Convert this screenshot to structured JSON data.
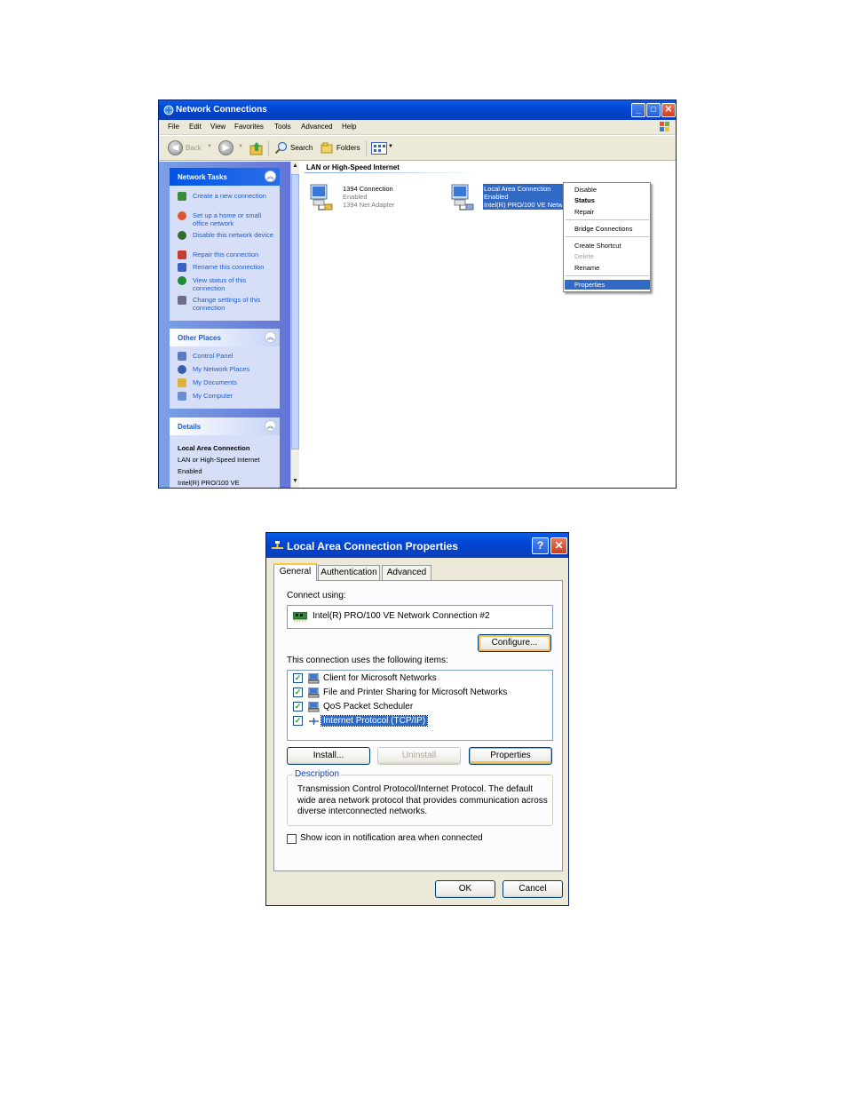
{
  "network_connections": {
    "title": "Network Connections",
    "menu": [
      "File",
      "Edit",
      "View",
      "Favorites",
      "Tools",
      "Advanced",
      "Help"
    ],
    "toolbar": {
      "back": "Back",
      "search": "Search",
      "folders": "Folders"
    },
    "network_tasks": {
      "header": "Network Tasks",
      "items": [
        {
          "label": "Create a new connection",
          "icon": "new-connection-icon",
          "color": "#3c8c3c"
        },
        {
          "label": "Set up a home or small office network",
          "icon": "home-network-icon",
          "color": "#d9572b"
        },
        {
          "label": "Disable this network device",
          "icon": "disable-device-icon",
          "color": "#2d6e2d"
        },
        {
          "label": "Repair this connection",
          "icon": "repair-icon",
          "color": "#c2402a"
        },
        {
          "label": "Rename this connection",
          "icon": "rename-icon",
          "color": "#3a62c1"
        },
        {
          "label": "View status of this connection",
          "icon": "status-icon",
          "color": "#1e8c3a"
        },
        {
          "label": "Change settings of this connection",
          "icon": "settings-icon",
          "color": "#6e6e8c"
        }
      ]
    },
    "other_places": {
      "header": "Other Places",
      "items": [
        {
          "label": "Control Panel",
          "icon": "control-panel-icon",
          "color": "#5a7bc2"
        },
        {
          "label": "My Network Places",
          "icon": "network-places-icon",
          "color": "#3a5fb0"
        },
        {
          "label": "My Documents",
          "icon": "documents-icon",
          "color": "#e0b23c"
        },
        {
          "label": "My Computer",
          "icon": "computer-icon",
          "color": "#6a8ed8"
        }
      ]
    },
    "details": {
      "header": "Details",
      "name": "Local Area Connection",
      "type": "LAN or High-Speed Internet",
      "status": "Enabled",
      "device": "Intel(R) PRO/100 VE"
    },
    "group_header": "LAN or High-Speed Internet",
    "connections": [
      {
        "name": "1394 Connection",
        "status": "Enabled",
        "device": "1394 Net Adapter"
      },
      {
        "name": "Local Area Connection",
        "status": "Enabled",
        "device": "Intel(R) PRO/100 VE Netw"
      }
    ],
    "context_menu": [
      "Disable",
      "Status",
      "Repair",
      "Bridge Connections",
      "Create Shortcut",
      "Delete",
      "Rename",
      "Properties"
    ]
  },
  "properties_dialog": {
    "title": "Local Area Connection Properties",
    "tabs": [
      "General",
      "Authentication",
      "Advanced"
    ],
    "connect_using_label": "Connect using:",
    "adapter": "Intel(R) PRO/100 VE Network Connection #2",
    "configure_button": "Configure...",
    "items_label": "This connection uses the following items:",
    "items": [
      {
        "label": "Client for Microsoft Networks",
        "checked": true
      },
      {
        "label": "File and Printer Sharing for Microsoft Networks",
        "checked": true
      },
      {
        "label": "QoS Packet Scheduler",
        "checked": true
      },
      {
        "label": "Internet Protocol (TCP/IP)",
        "checked": true,
        "selected": true
      }
    ],
    "install_button": "Install...",
    "uninstall_button": "Uninstall",
    "properties_button": "Properties",
    "description_label": "Description",
    "description_text": "Transmission Control Protocol/Internet Protocol. The default wide area network protocol that provides communication across diverse interconnected networks.",
    "show_icon_label": "Show icon in notification area when connected",
    "ok_button": "OK",
    "cancel_button": "Cancel",
    "help_glyph": "?",
    "close_glyph": "✕"
  },
  "colors": {
    "titlebar": "#0046d5",
    "task_link": "#215dc6",
    "selection": "#316ac5"
  }
}
